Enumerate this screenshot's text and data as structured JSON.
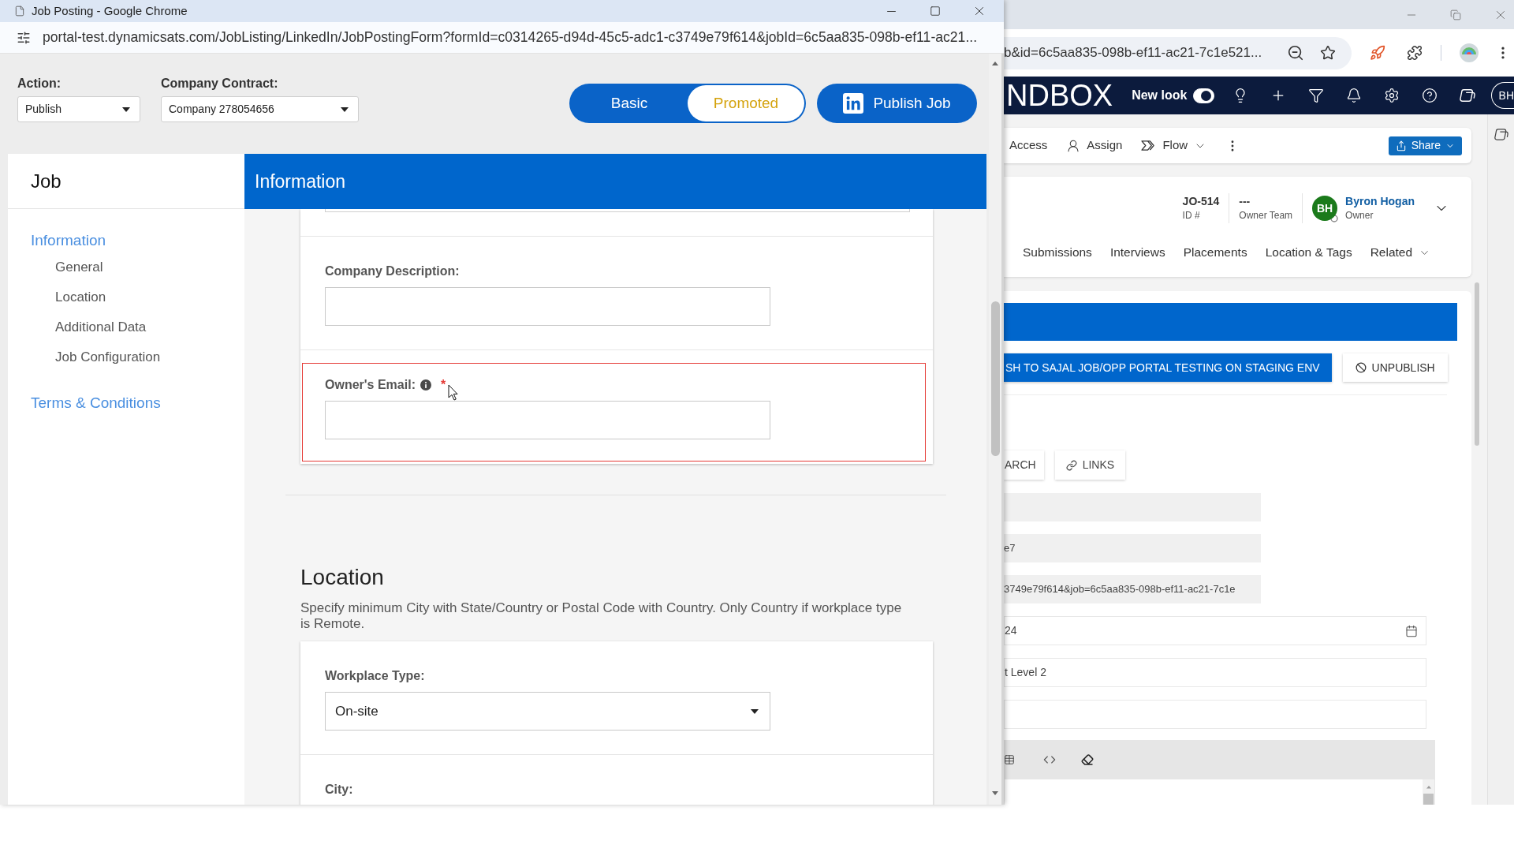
{
  "popup_window": {
    "title": "Job Posting - Google Chrome",
    "url": "portal-test.dynamicsats.com/JobListing/LinkedIn/JobPostingForm?formId=c0314265-d94d-45c5-adc1-c3749e79f614&jobId=6c5aa835-098b-ef11-ac21..."
  },
  "action_bar": {
    "selects": [
      {
        "label": "Action:",
        "value": "Publish"
      },
      {
        "label": "Company Contract:",
        "value": "Company 278054656"
      }
    ],
    "plan_options": [
      {
        "label": "Basic",
        "selected": false
      },
      {
        "label": "Promoted",
        "selected": true
      }
    ],
    "publish_button": "Publish Job"
  },
  "sidebar": {
    "title": "Job",
    "items": [
      {
        "label": "Information",
        "children": [
          {
            "label": "General"
          },
          {
            "label": "Location"
          },
          {
            "label": "Additional Data"
          },
          {
            "label": "Job Configuration"
          }
        ]
      },
      {
        "label": "Terms & Conditions"
      }
    ]
  },
  "section_header": "Information",
  "information_card": {
    "fields": [
      {
        "kind": "clipped",
        "error": false
      },
      {
        "label": "Company Description:",
        "kind": "text",
        "info": false,
        "error": false
      },
      {
        "label": "Owner's Email:",
        "kind": "text",
        "info": true,
        "required_mark": "*",
        "error": true
      }
    ]
  },
  "location_section": {
    "title": "Location",
    "description": "Specify minimum City with State/Country or Postal Code with Country. Only Country if workplace type is Remote.",
    "fields": [
      {
        "label": "Workplace Type:",
        "kind": "select",
        "value": "On-site",
        "info": false,
        "error": false
      },
      {
        "label": "City:",
        "kind": "label",
        "info": false,
        "error": false
      }
    ]
  },
  "background_app": {
    "url": "b&id=6c5aa835-098b-ef11-ac21-7c1e521...",
    "brand": "NDBOX",
    "new_look": {
      "label": "New look",
      "on": true
    },
    "avatar": "BH",
    "commands": [
      {
        "label": "Access",
        "menu": false
      },
      {
        "label": "Assign",
        "menu": false
      },
      {
        "label": "Flow",
        "menu": true
      }
    ],
    "share_button": "Share",
    "record": {
      "fields": [
        {
          "value": "JO-514",
          "label": "ID #"
        },
        {
          "value": "---",
          "label": "Owner Team"
        }
      ],
      "owner": {
        "initials": "BH",
        "name": "Byron Hogan",
        "role": "Owner"
      }
    },
    "tabs": [
      {
        "label": "Submissions",
        "selected": false,
        "menu": false
      },
      {
        "label": "Interviews",
        "selected": false,
        "menu": false
      },
      {
        "label": "Placements",
        "selected": false,
        "menu": false
      },
      {
        "label": "Location & Tags",
        "selected": false,
        "menu": false
      },
      {
        "label": "Related",
        "selected": false,
        "menu": true
      }
    ],
    "portal_buttons": [
      {
        "label": "SH TO SAJAL JOB/OPP PORTAL TESTING ON STAGING ENV",
        "kind": "primary"
      },
      {
        "label": "UNPUBLISH",
        "kind": "secondary"
      }
    ],
    "link_buttons": [
      "ARCH",
      "LINKS"
    ],
    "fields": [
      {
        "kind": "readonly"
      },
      {
        "kind": "readonly",
        "value": "e7"
      },
      {
        "kind": "readonly",
        "value": "3749e79f614&job=6c5aa835-098b-ef11-ac21-7c1e"
      },
      {
        "kind": "date",
        "value": "24"
      },
      {
        "kind": "text",
        "value": "t Level 2"
      },
      {
        "kind": "text"
      }
    ]
  }
}
